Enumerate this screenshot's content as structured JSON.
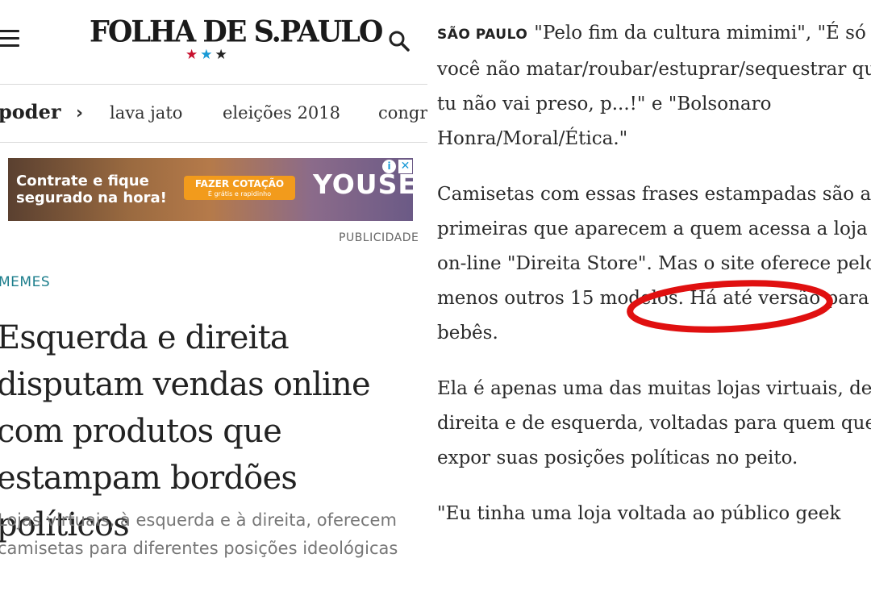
{
  "header": {
    "logo_text": "FOLHA DE S.PAULO",
    "stars": [
      "★",
      "★",
      "★"
    ],
    "star_colors": [
      "#c8102e",
      "#1a9ad6",
      "#222222"
    ]
  },
  "nav": {
    "section": "poder",
    "chevron": "›",
    "links": [
      "lava jato",
      "eleições 2018",
      "congresso"
    ]
  },
  "ad": {
    "headline": "Contrate e fique segurado na hora!",
    "cta_main": "FAZER COTAÇÃO",
    "cta_sub": "É grátis e rapidinho",
    "brand": "YOUSE",
    "info_icon": "i",
    "close_icon": "✕",
    "label": "PUBLICIDADE"
  },
  "article": {
    "kicker": "MEMES",
    "headline": "Esquerda e direita disputam vendas online com produtos que estampam bordões políticos",
    "dek": "Lojas virtuais, à esquerda e à direita, oferecem camisetas para diferentes posições ideológicas"
  },
  "body": {
    "dateline": "SÃO PAULO",
    "p1": "\"Pelo fim da cultura mimimi\", \"É só você não matar/roubar/estuprar/sequestrar que tu não vai preso, p...!\" e \"Bolsonaro Honra/Moral/Ética.\"",
    "p2": "Camisetas com essas frases estampadas são as primeiras que aparecem a quem acessa a loja on-line \"Direita Store\". Mas o site oferece pelo menos outros 15 modelos. Há até versão para bebês.",
    "p3": "Ela é apenas uma das muitas lojas virtuais, de direita e de esquerda, voltadas para quem quer expor suas posições políticas no peito.",
    "p4": "\"Eu tinha uma loja voltada ao público geek"
  },
  "annotation": {
    "circle_color": "#e01010"
  }
}
